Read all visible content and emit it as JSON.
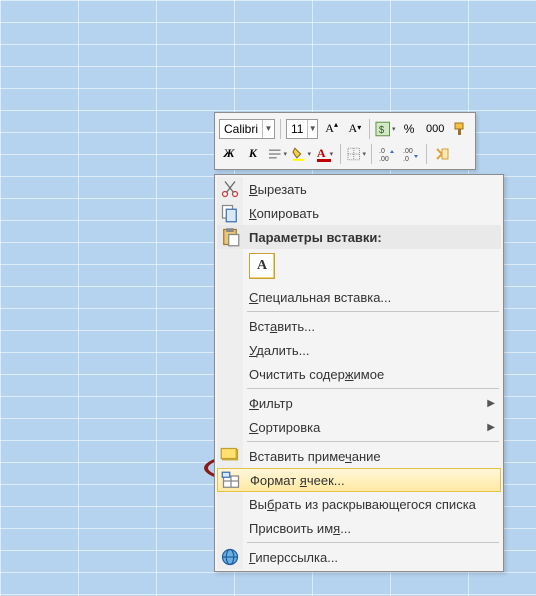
{
  "toolbar": {
    "font_name": "Calibri",
    "font_size": "11",
    "percent": "%",
    "thousands": "000"
  },
  "menu": {
    "cut": "Вырезать",
    "copy": "Копировать",
    "paste_options_header": "Параметры вставки:",
    "paste_opt_glyph": "A",
    "paste_special": "Специальная вставка...",
    "insert": "Вставить...",
    "delete": "Удалить...",
    "clear_contents": "Очистить содержимое",
    "filter": "Фильтр",
    "sort": "Сортировка",
    "insert_comment": "Вставить примечание",
    "format_cells": "Формат ячеек...",
    "pick_from_list": "Выбрать из раскрывающегося списка",
    "assign_name": "Присвоить имя...",
    "hyperlink": "Гиперссылка..."
  }
}
